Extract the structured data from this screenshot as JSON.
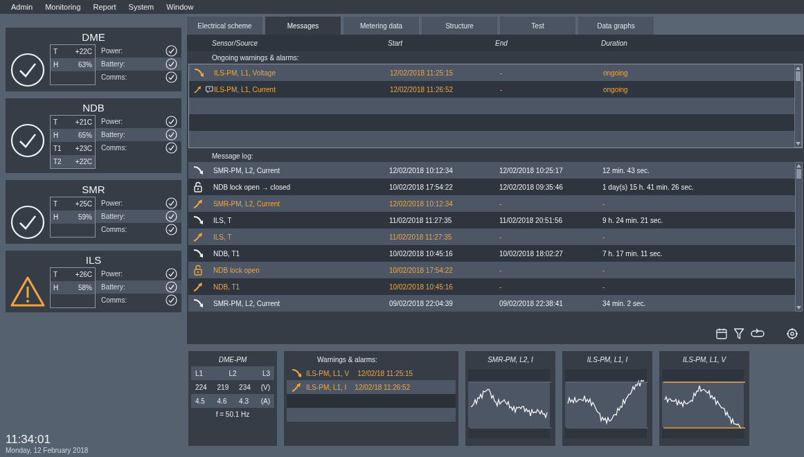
{
  "menu": [
    "Admin",
    "Monitoring",
    "Report",
    "System",
    "Window"
  ],
  "stations": [
    {
      "name": "DME",
      "warning": false,
      "readings": [
        {
          "label": "T",
          "value": "+22C"
        },
        {
          "label": "H",
          "value": "63%"
        }
      ],
      "checks": [
        {
          "label": "Power:",
          "ok": true
        },
        {
          "label": "Battery:",
          "ok": true
        },
        {
          "label": "Comms:",
          "ok": true
        }
      ]
    },
    {
      "name": "NDB",
      "warning": false,
      "readings": [
        {
          "label": "T",
          "value": "+21C"
        },
        {
          "label": "H",
          "value": "65%"
        },
        {
          "label": "T1",
          "value": "+23C"
        },
        {
          "label": "T2",
          "value": "+22C"
        }
      ],
      "checks": [
        {
          "label": "Power:",
          "ok": true
        },
        {
          "label": "Battery:",
          "ok": true
        },
        {
          "label": "Comms:",
          "ok": true
        }
      ]
    },
    {
      "name": "SMR",
      "warning": false,
      "readings": [
        {
          "label": "T",
          "value": "+25C"
        },
        {
          "label": "H",
          "value": "59%"
        }
      ],
      "checks": [
        {
          "label": "Power:",
          "ok": true
        },
        {
          "label": "Battery:",
          "ok": true
        },
        {
          "label": "Comms:",
          "ok": true
        }
      ]
    },
    {
      "name": "ILS",
      "warning": true,
      "readings": [
        {
          "label": "T",
          "value": "+26C"
        },
        {
          "label": "H",
          "value": "58%"
        }
      ],
      "checks": [
        {
          "label": "Power:",
          "ok": true
        },
        {
          "label": "Battery:",
          "ok": true
        },
        {
          "label": "Comms:",
          "ok": true
        }
      ]
    }
  ],
  "clock": {
    "time": "11:34:01",
    "date": "Monday, 12 February 2018"
  },
  "tabs": [
    {
      "label": "Electrical scheme",
      "selected": false
    },
    {
      "label": "Messages",
      "selected": true
    },
    {
      "label": "Metering data",
      "selected": false
    },
    {
      "label": "Structure",
      "selected": false
    },
    {
      "label": "Test",
      "selected": false
    },
    {
      "label": "Data graphs",
      "selected": false
    }
  ],
  "columns": [
    "Sensor/Source",
    "Start",
    "End",
    "Duration"
  ],
  "ongoing": {
    "label": "Ongoing warnings & alarms:",
    "rows": [
      {
        "kind": "falling",
        "alarm": true,
        "comment": false,
        "source": "ILS-PM, L1, Voltage",
        "start": "12/02/2018 11:25:15",
        "end": "-",
        "duration": "ongoing"
      },
      {
        "kind": "rising",
        "alarm": true,
        "comment": true,
        "source": "ILS-PM, L1, Current",
        "start": "12/02/2018 11:26:52",
        "end": "-",
        "duration": "ongoing"
      }
    ]
  },
  "log": {
    "label": "Message log:",
    "rows": [
      {
        "kind": "falling",
        "alarm": false,
        "source": "SMR-PM, L2, Current",
        "start": "12/02/2018 10:12:34",
        "end": "12/02/2018 10:25:17",
        "duration": "12 min. 43 sec."
      },
      {
        "kind": "lock",
        "alarm": false,
        "source": "NDB lock open → closed",
        "start": "10/02/2018 17:54:22",
        "end": "12/02/2018 09:35:46",
        "duration": "1 day(s) 15 h. 41 min. 26 sec."
      },
      {
        "kind": "rising",
        "alarm": true,
        "source": "SMR-PM, L2, Current",
        "start": "12/02/2018 10:12:34",
        "end": "-",
        "duration": "-"
      },
      {
        "kind": "falling",
        "alarm": false,
        "source": "ILS, T",
        "start": "11/02/2018 11:27:35",
        "end": "11/02/2018 20:51:56",
        "duration": "9 h. 24 min. 21 sec."
      },
      {
        "kind": "rising",
        "alarm": true,
        "source": "ILS, T",
        "start": "11/02/2018 11:27:35",
        "end": "-",
        "duration": "-"
      },
      {
        "kind": "falling",
        "alarm": false,
        "source": "NDB, T1",
        "start": "10/02/2018 10:45:16",
        "end": "10/02/2018 18:02:27",
        "duration": "7 h. 17 min. 11 sec."
      },
      {
        "kind": "lock",
        "alarm": true,
        "source": "NDB lock open",
        "start": "10/02/2018 17:54:22",
        "end": "-",
        "duration": "-"
      },
      {
        "kind": "rising",
        "alarm": true,
        "source": "NDB, T1",
        "start": "10/02/2018 10:45:16",
        "end": "-",
        "duration": "-"
      },
      {
        "kind": "falling",
        "alarm": false,
        "source": "SMR-PM, L2, Current",
        "start": "09/02/2018 22:04:39",
        "end": "09/02/2018 22:38:41",
        "duration": "34 min. 2 sec."
      }
    ]
  },
  "meter": {
    "title": "DME-PM",
    "header": [
      "L1",
      "L2",
      "L3"
    ],
    "rows": [
      [
        "224",
        "219",
        "234",
        "(V)"
      ],
      [
        "4.5",
        "4.6",
        "4.3",
        "(A)"
      ]
    ],
    "frequency": "f = 50.1 Hz"
  },
  "warnings": {
    "title": "Warnings & alarms:",
    "items": [
      {
        "kind": "falling",
        "source": "ILS-PM, L1, V",
        "time": "12/02/18 11:25:15"
      },
      {
        "kind": "rising",
        "source": "ILS-PM, L1, I",
        "time": "12/02/18 11:26:52"
      }
    ]
  },
  "graphs": [
    {
      "title": "SMR-PM, L2, I",
      "alarm": false
    },
    {
      "title": "ILS-PM, L1, I",
      "alarm": false
    },
    {
      "title": "ILS-PM, L1, V",
      "alarm": true
    }
  ]
}
